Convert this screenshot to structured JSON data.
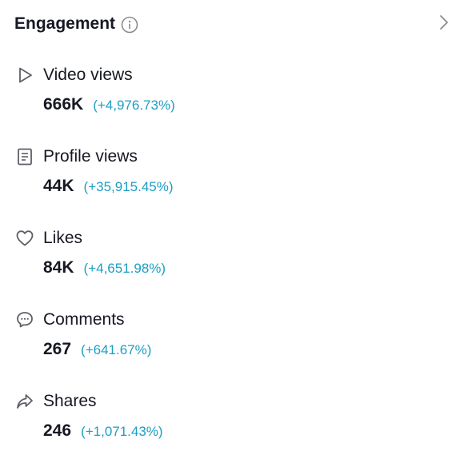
{
  "header": {
    "title": "Engagement",
    "info_icon": "info-icon",
    "chevron_icon": "chevron-right-icon"
  },
  "colors": {
    "text": "#161823",
    "change": "#1c9ec4",
    "icon": "#6b6b70"
  },
  "metrics": [
    {
      "label": "Video views",
      "value": "666K",
      "change": "(+4,976.73%)",
      "icon": "play-icon"
    },
    {
      "label": "Profile views",
      "value": "44K",
      "change": "(+35,915.45%)",
      "icon": "profile-card-icon"
    },
    {
      "label": "Likes",
      "value": "84K",
      "change": "(+4,651.98%)",
      "icon": "heart-icon"
    },
    {
      "label": "Comments",
      "value": "267",
      "change": "(+641.67%)",
      "icon": "comment-icon"
    },
    {
      "label": "Shares",
      "value": "246",
      "change": "(+1,071.43%)",
      "icon": "share-icon"
    }
  ]
}
